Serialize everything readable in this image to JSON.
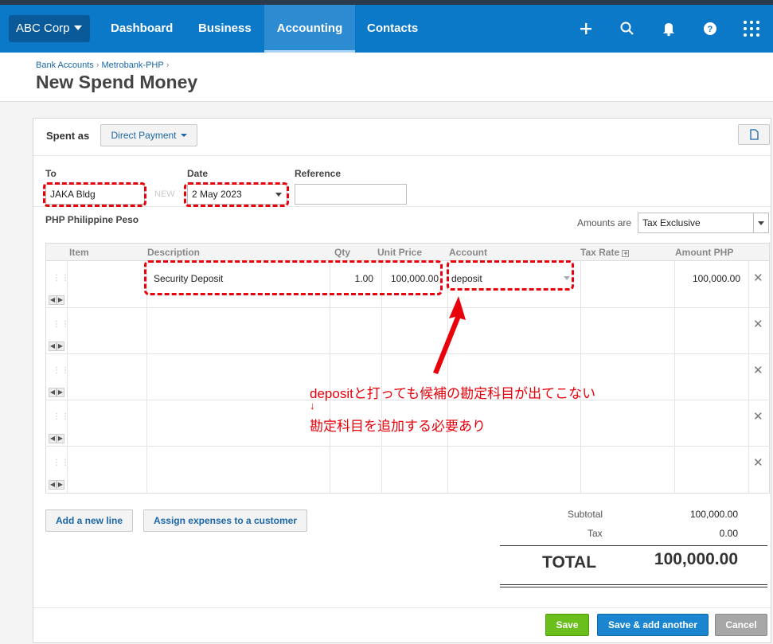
{
  "nav": {
    "org": "ABC Corp",
    "items": [
      {
        "label": "Dashboard"
      },
      {
        "label": "Business"
      },
      {
        "label": "Accounting"
      },
      {
        "label": "Contacts"
      }
    ]
  },
  "breadcrumb": {
    "items": [
      "Bank Accounts",
      "Metrobank-PHP"
    ]
  },
  "page": {
    "title": "New Spend Money"
  },
  "form": {
    "spent_as_label": "Spent as",
    "spent_as_value": "Direct Payment",
    "to_label": "To",
    "to_value": "JAKA Bldg",
    "new_badge": "NEW",
    "date_label": "Date",
    "date_value": "2 May 2023",
    "reference_label": "Reference",
    "reference_value": "",
    "currency": "PHP Philippine Peso",
    "amounts_are_label": "Amounts are",
    "amounts_are_value": "Tax Exclusive"
  },
  "table": {
    "headers": [
      "Item",
      "Description",
      "Qty",
      "Unit Price",
      "Account",
      "Tax Rate",
      "Amount PHP"
    ],
    "rows": [
      {
        "item": "",
        "description": "Security Deposit",
        "qty": "1.00",
        "unit_price": "100,000.00",
        "account": "deposit",
        "tax_rate": "",
        "amount": "100,000.00"
      },
      {
        "item": "",
        "description": "",
        "qty": "",
        "unit_price": "",
        "account": "",
        "tax_rate": "",
        "amount": ""
      },
      {
        "item": "",
        "description": "",
        "qty": "",
        "unit_price": "",
        "account": "",
        "tax_rate": "",
        "amount": ""
      },
      {
        "item": "",
        "description": "",
        "qty": "",
        "unit_price": "",
        "account": "",
        "tax_rate": "",
        "amount": ""
      },
      {
        "item": "",
        "description": "",
        "qty": "",
        "unit_price": "",
        "account": "",
        "tax_rate": "",
        "amount": ""
      }
    ]
  },
  "annotation": {
    "line1": "depositと打っても候補の勘定科目が出てこない",
    "arrow": "↓",
    "line2": "勘定科目を追加する必要あり",
    "color": "#e8000b"
  },
  "actions": {
    "add_line": "Add a new line",
    "assign_expenses": "Assign expenses to a customer",
    "save": "Save",
    "save_add": "Save & add another",
    "cancel": "Cancel"
  },
  "totals": {
    "subtotal_label": "Subtotal",
    "subtotal_value": "100,000.00",
    "tax_label": "Tax",
    "tax_value": "0.00",
    "total_label": "TOTAL",
    "total_value": "100,000.00"
  },
  "colors": {
    "nav": "#0c78c8",
    "accent": "#1a66a8",
    "save": "#6bbf1d"
  }
}
